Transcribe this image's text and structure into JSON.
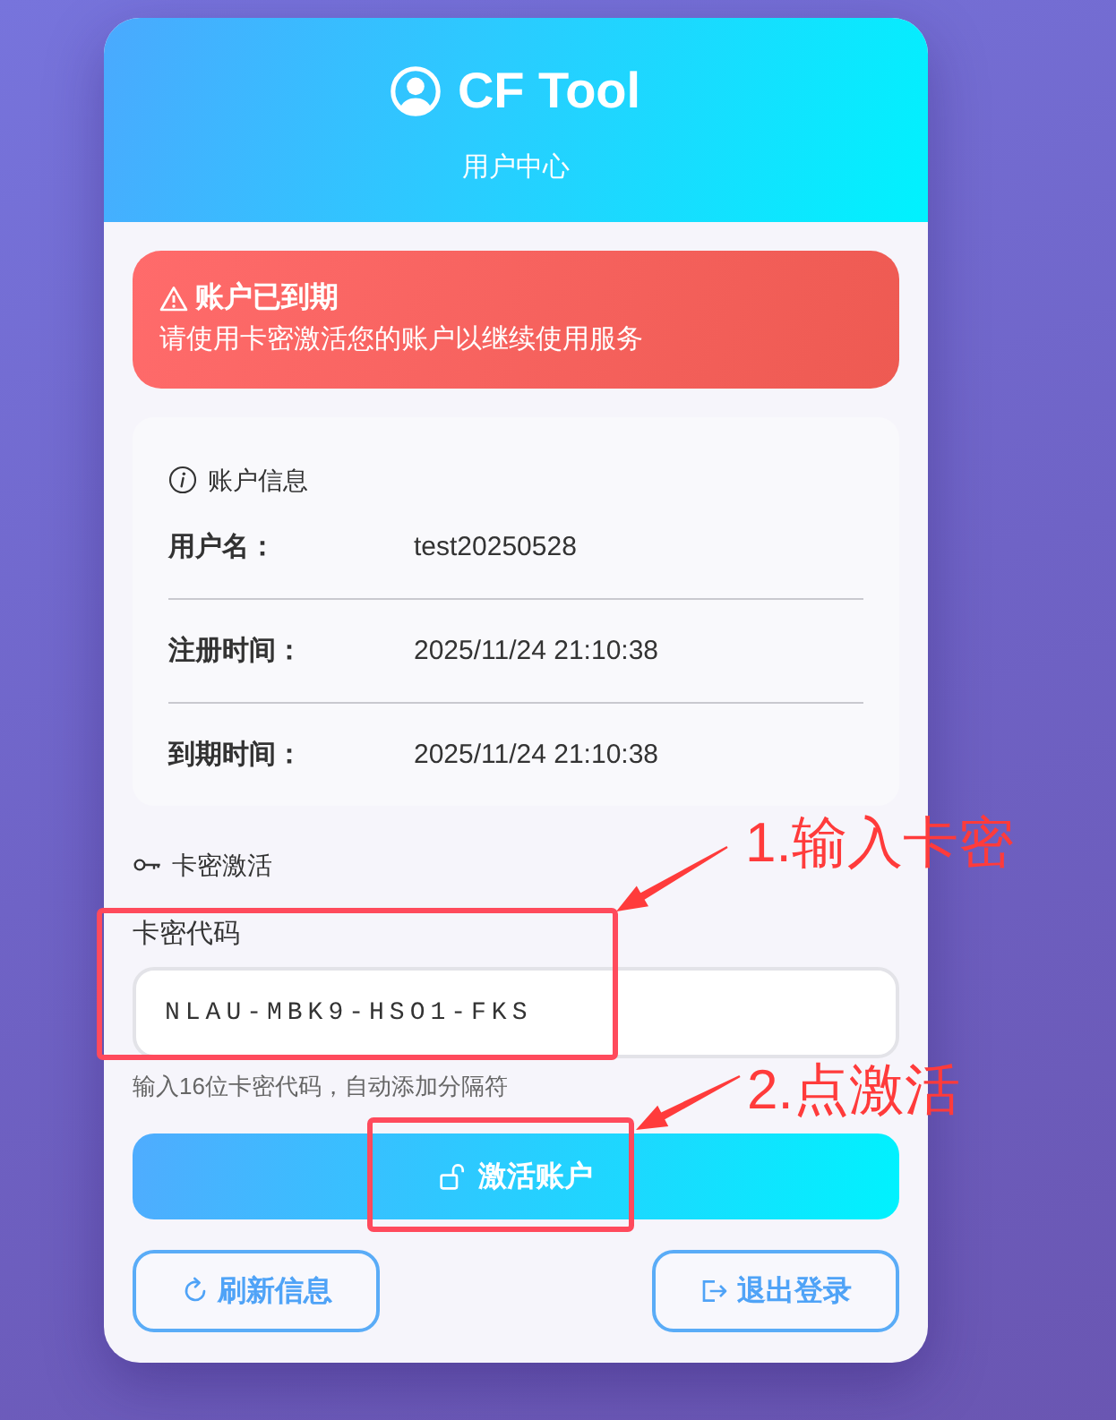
{
  "header": {
    "title": "CF Tool",
    "subtitle": "用户中心"
  },
  "alert": {
    "title": "账户已到期",
    "message": "请使用卡密激活您的账户以继续使用服务"
  },
  "account_info": {
    "heading": "账户信息",
    "fields": [
      {
        "label": "用户名：",
        "value": "test20250528"
      },
      {
        "label": "注册时间：",
        "value": "2025/11/24 21:10:38"
      },
      {
        "label": "到期时间：",
        "value": "2025/11/24 21:10:38"
      }
    ]
  },
  "activation": {
    "heading": "卡密激活",
    "field_label": "卡密代码",
    "value": "NLAU-MBK9-HSO1-FKS",
    "hint": "输入16位卡密代码，自动添加分隔符",
    "button": "激活账户"
  },
  "refresh_button": {
    "label": "刷新信息"
  },
  "logout_button": {
    "label": "退出登录"
  },
  "annotations": [
    {
      "text": "1.输入卡密"
    },
    {
      "text": "2.点激活"
    }
  ]
}
